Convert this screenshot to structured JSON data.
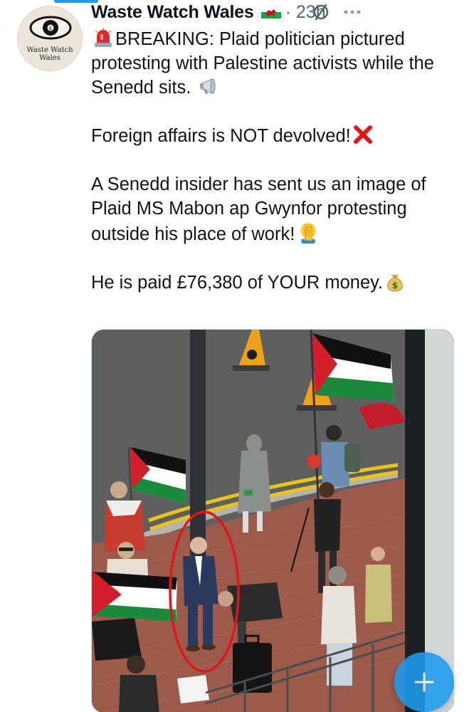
{
  "account": {
    "avatar_text": "Waste Watch Wales",
    "display_name": "Waste Watch Wales",
    "flag_icon": "wales-flag-icon",
    "time": "· 23h"
  },
  "header_icons": {
    "grok": "grok-icon",
    "more": "more-dots-icon"
  },
  "tweet": {
    "line1_text": "BREAKING: Plaid politician pictured protesting with Palestine activists while the Senedd sits.",
    "line1_lead_icon": "police-light-icon",
    "line1_trail_icon": "megaphone-icon",
    "line2_text": "Foreign affairs is NOT devolved!",
    "line2_trail_icon": "red-cross-mark-icon",
    "line3_text": "A Senedd insider has sent us an image of Plaid MS Mabon ap Gwynfor protesting outside his place of work!",
    "line3_trail_icon": "facepalm-icon",
    "line4_text": "He is paid £76,380 of YOUR money.",
    "line4_trail_icon": "money-bag-icon"
  },
  "media": {
    "description_icon": "protest-photo"
  },
  "compose": {
    "icon": "plus-icon"
  },
  "colors": {
    "accent": "#1d9bf0",
    "time_gray": "#536471",
    "circle_red": "#e0161b"
  }
}
